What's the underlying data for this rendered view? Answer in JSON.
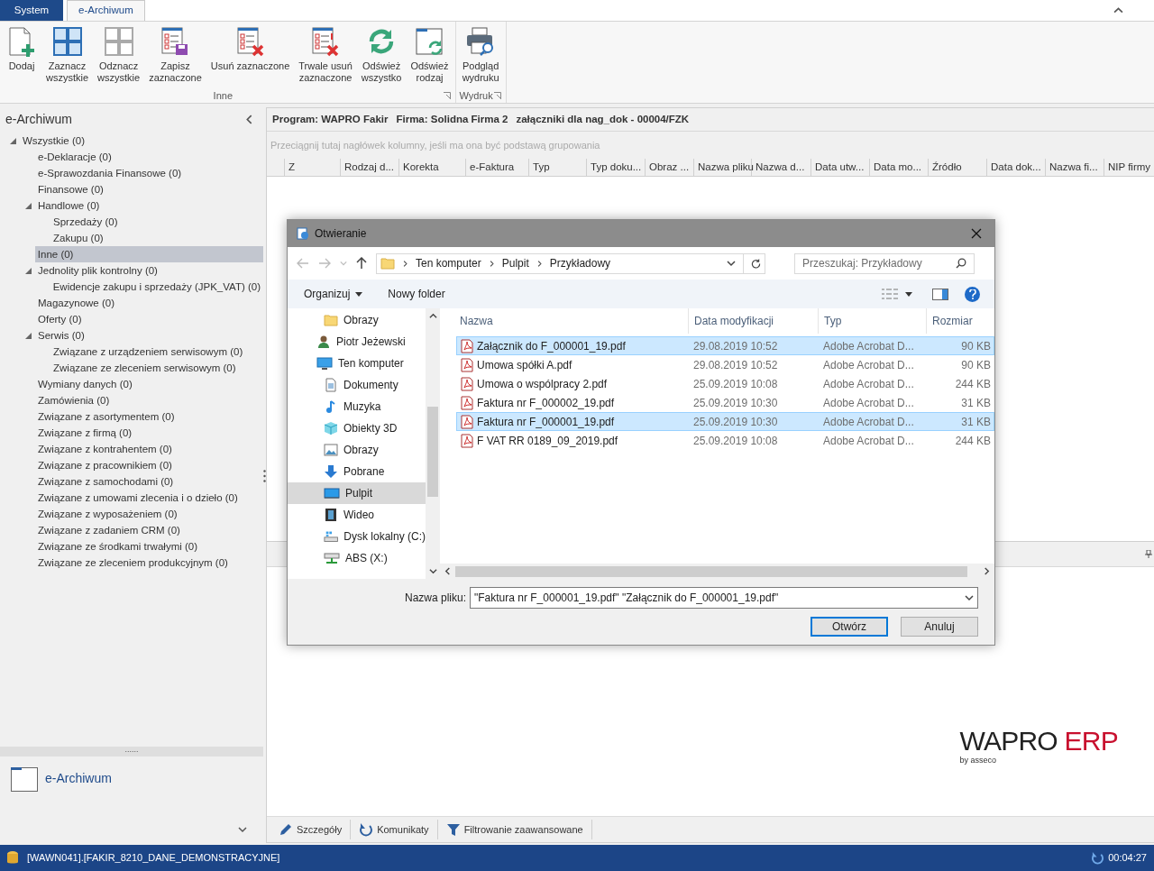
{
  "tabs": [
    {
      "label": "System",
      "kind": "app",
      "selected": false
    },
    {
      "label": "e-Archiwum",
      "kind": "page",
      "selected": true
    }
  ],
  "ribbon": {
    "groups": [
      {
        "label": "Inne",
        "buttons": [
          {
            "label": "Dodaj",
            "kind": "add"
          },
          {
            "label": "Zaznacz\nwszystkie",
            "kind": "select-all"
          },
          {
            "label": "Odznacz\nwszystkie",
            "kind": "deselect-all"
          },
          {
            "label": "Zapisz\nzaznaczone",
            "kind": "save"
          },
          {
            "label": "Usuń zaznaczone",
            "kind": "delete"
          },
          {
            "label": "Trwale usuń\nzaznaczone",
            "kind": "delete-permanent"
          },
          {
            "label": "Odśwież\nwszystko",
            "kind": "refresh"
          },
          {
            "label": "Odśwież\nrodzaj",
            "kind": "refresh-folder"
          }
        ]
      },
      {
        "label": "Wydruk",
        "buttons": [
          {
            "label": "Podgląd\nwydruku",
            "kind": "print-preview"
          }
        ]
      }
    ]
  },
  "sidebar": {
    "title": "e-Archiwum",
    "tree": [
      {
        "label": "Wszystkie (0)",
        "expanded": true,
        "selected": false,
        "children": [
          {
            "label": "e-Deklaracje (0)",
            "selected": false
          },
          {
            "label": "e-Sprawozdania Finansowe (0)",
            "selected": false
          },
          {
            "label": "Finansowe (0)",
            "selected": false
          },
          {
            "label": "Handlowe (0)",
            "expanded": true,
            "selected": false,
            "children": [
              {
                "label": "Sprzedaży (0)",
                "selected": false
              },
              {
                "label": "Zakupu (0)",
                "selected": false
              }
            ]
          },
          {
            "label": "Inne (0)",
            "selected": true
          },
          {
            "label": "Jednolity plik kontrolny (0)",
            "expanded": true,
            "selected": false,
            "children": [
              {
                "label": "Ewidencje zakupu i sprzedaży (JPK_VAT) (0)",
                "selected": false
              }
            ]
          },
          {
            "label": "Magazynowe (0)",
            "selected": false
          },
          {
            "label": "Oferty (0)",
            "selected": false
          },
          {
            "label": "Serwis (0)",
            "expanded": true,
            "selected": false,
            "children": [
              {
                "label": "Związane z urządzeniem serwisowym (0)",
                "selected": false
              },
              {
                "label": "Związane ze zleceniem serwisowym (0)",
                "selected": false
              }
            ]
          },
          {
            "label": "Wymiany danych (0)",
            "selected": false
          },
          {
            "label": "Zamówienia (0)",
            "selected": false
          },
          {
            "label": "Związane z asortymentem (0)",
            "selected": false
          },
          {
            "label": "Związane z firmą (0)",
            "selected": false
          },
          {
            "label": "Związane z kontrahentem (0)",
            "selected": false
          },
          {
            "label": "Związane z pracownikiem (0)",
            "selected": false
          },
          {
            "label": "Związane z samochodami (0)",
            "selected": false
          },
          {
            "label": "Związane z umowami zlecenia i o dzieło (0)",
            "selected": false
          },
          {
            "label": "Związane z wyposażeniem (0)",
            "selected": false
          },
          {
            "label": "Związane z zadaniem CRM (0)",
            "selected": false
          },
          {
            "label": "Związane ze środkami trwałymi (0)",
            "selected": false
          },
          {
            "label": "Związane ze zleceniem produkcyjnym (0)",
            "selected": false
          }
        ]
      }
    ],
    "splitter": "......",
    "nav_item": "e-Archiwum"
  },
  "main": {
    "header": [
      "Program: WAPRO Fakir",
      "Firma: Solidna Firma 2",
      "załączniki dla nag_dok - 00004/FZK"
    ],
    "group_hint": "Przeciągnij tutaj nagłówek kolumny, jeśli ma ona być podstawą grupowania",
    "columns": [
      "Z",
      "Rodzaj d...",
      "Korekta",
      "e-Faktura",
      "Typ",
      "Typ doku...",
      "Obraz ...",
      "Nazwa pliku",
      "Nazwa d...",
      "Data utw...",
      "Data mo...",
      "Źródło",
      "Data dok...",
      "Nazwa fi...",
      "NIP firmy"
    ],
    "toolbar": [
      {
        "label": "Szczegóły",
        "kind": "edit"
      },
      {
        "label": "Komunikaty",
        "kind": "refresh"
      },
      {
        "label": "Filtrowanie zaawansowane",
        "kind": "filter"
      }
    ],
    "logo": {
      "brand": "WAPRO",
      "product": "ERP",
      "by": "by asseco"
    }
  },
  "dialog": {
    "title": "Otwieranie",
    "path": [
      "Ten komputer",
      "Pulpit",
      "Przykładowy"
    ],
    "search": {
      "placeholder": "Przeszukaj: Przykładowy"
    },
    "commands": [
      "Organizuj",
      "Nowy folder"
    ],
    "nav": [
      {
        "label": "Obrazy",
        "kind": "folder",
        "selected": false
      },
      {
        "label": "Piotr Jeżewski",
        "kind": "user",
        "selected": false
      },
      {
        "label": "Ten komputer",
        "kind": "computer",
        "selected": false,
        "children": [
          {
            "label": "Dokumenty",
            "kind": "documents",
            "selected": false
          },
          {
            "label": "Muzyka",
            "kind": "music",
            "selected": false
          },
          {
            "label": "Obiekty 3D",
            "kind": "objects",
            "selected": false
          },
          {
            "label": "Obrazy",
            "kind": "pictures",
            "selected": false
          },
          {
            "label": "Pobrane",
            "kind": "downloads",
            "selected": false
          },
          {
            "label": "Pulpit",
            "kind": "desktop",
            "selected": true
          },
          {
            "label": "Wideo",
            "kind": "video",
            "selected": false
          },
          {
            "label": "Dysk lokalny (C:)",
            "kind": "drive",
            "selected": false
          },
          {
            "label": "ABS (X:)",
            "kind": "network-drive",
            "selected": false
          }
        ]
      }
    ],
    "columns": [
      "Nazwa",
      "Data modyfikacji",
      "Typ",
      "Rozmiar"
    ],
    "files": [
      {
        "name": "Załącznik do F_000001_19.pdf",
        "modified": "29.08.2019 10:52",
        "type": "Adobe Acrobat D...",
        "size": "90 KB",
        "selected": true
      },
      {
        "name": "Umowa spółki A.pdf",
        "modified": "29.08.2019 10:52",
        "type": "Adobe Acrobat D...",
        "size": "90 KB",
        "selected": false
      },
      {
        "name": "Umowa o wspólpracy 2.pdf",
        "modified": "25.09.2019 10:08",
        "type": "Adobe Acrobat D...",
        "size": "244 KB",
        "selected": false
      },
      {
        "name": "Faktura nr F_000002_19.pdf",
        "modified": "25.09.2019 10:30",
        "type": "Adobe Acrobat D...",
        "size": "31 KB",
        "selected": false
      },
      {
        "name": "Faktura nr F_000001_19.pdf",
        "modified": "25.09.2019 10:30",
        "type": "Adobe Acrobat D...",
        "size": "31 KB",
        "selected": true
      },
      {
        "name": "F VAT RR 0189_09_2019.pdf",
        "modified": "25.09.2019 10:08",
        "type": "Adobe Acrobat D...",
        "size": "244 KB",
        "selected": false
      }
    ],
    "filename_label": "Nazwa pliku:",
    "filename": "\"Faktura nr F_000001_19.pdf\" \"Załącznik do F_000001_19.pdf\"",
    "buttons": [
      {
        "label": "Otwórz",
        "kind": "default"
      },
      {
        "label": "Anuluj",
        "kind": "normal"
      }
    ]
  },
  "status_bar": {
    "database": "[WAWN041].[FAKIR_8210_DANE_DEMONSTRACYJNE]",
    "time": "00:04:27"
  }
}
